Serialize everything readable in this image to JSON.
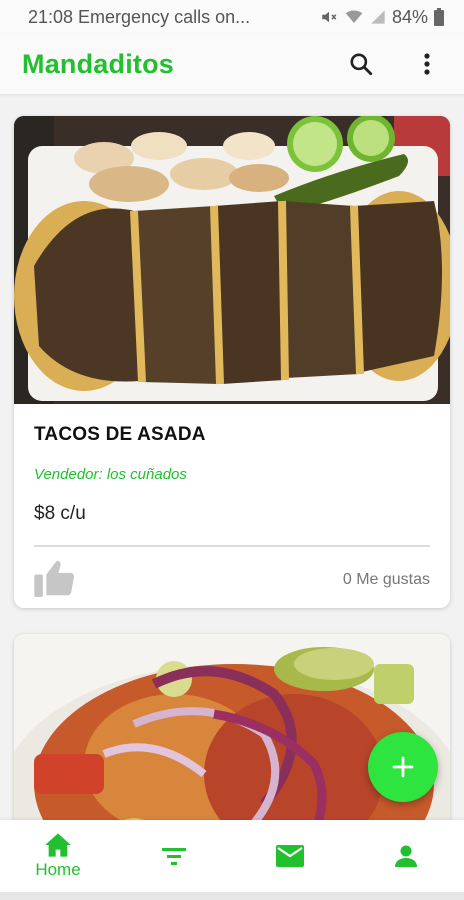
{
  "status_bar": {
    "time_text": "21:08 Emergency calls on...",
    "battery": "84%",
    "icons": [
      "mute-icon",
      "wifi-icon",
      "signal-icon",
      "battery-icon"
    ]
  },
  "app_bar": {
    "title": "Mandaditos",
    "actions": [
      "search-icon",
      "more-vert-icon"
    ]
  },
  "feed": {
    "posts": [
      {
        "title": "TACOS DE ASADA",
        "vendor": "Vendedor: los cuñados",
        "price": "$8 c/u",
        "likes": "0 Me gustas",
        "image": "tacos de asada photo"
      },
      {
        "image": "ceviche with red onion and avocado photo"
      }
    ]
  },
  "fab": {
    "icon": "plus-icon"
  },
  "bottom_nav": {
    "items": [
      {
        "icon": "home-icon",
        "label": "Home",
        "active": true
      },
      {
        "icon": "filter-icon"
      },
      {
        "icon": "mail-icon"
      },
      {
        "icon": "person-icon"
      }
    ]
  },
  "colors": {
    "accent": "#22c02f",
    "fab": "#2ee43f",
    "like_icon": "#c6c6c6"
  }
}
